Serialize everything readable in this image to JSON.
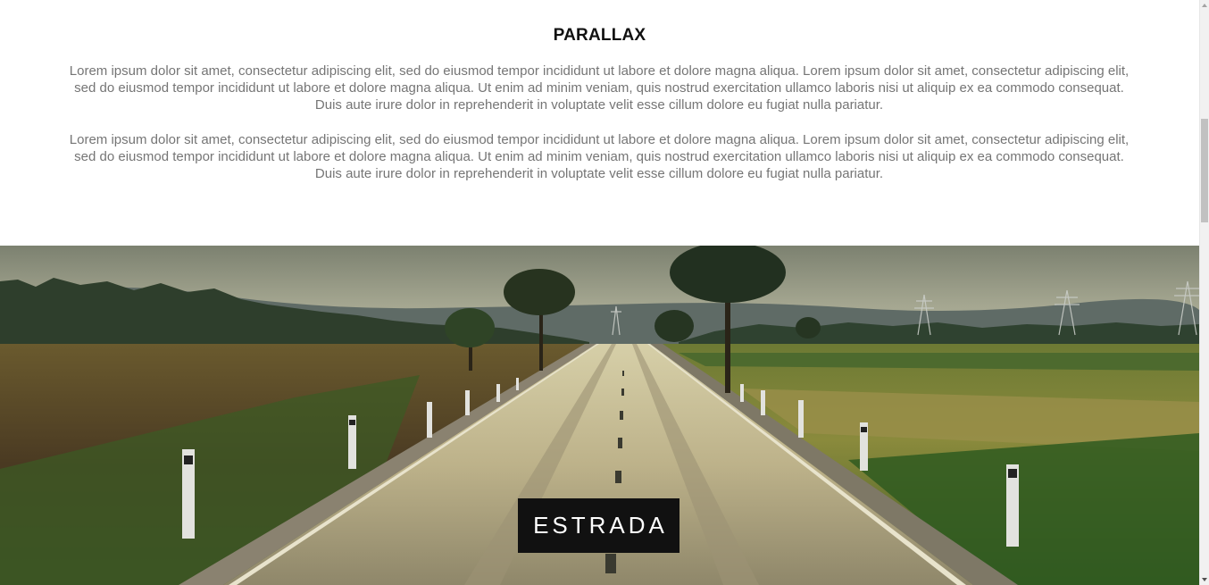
{
  "section": {
    "title": "PARALLAX",
    "paragraphs": [
      "Lorem ipsum dolor sit amet, consectetur adipiscing elit, sed do eiusmod tempor incididunt ut labore et dolore magna aliqua. Lorem ipsum dolor sit amet, consectetur adipiscing elit, sed do eiusmod tempor incididunt ut labore et dolore magna aliqua. Ut enim ad minim veniam, quis nostrud exercitation ullamco laboris nisi ut aliquip ex ea commodo consequat. Duis aute irure dolor in reprehenderit in voluptate velit esse cillum dolore eu fugiat nulla pariatur.",
      "Lorem ipsum dolor sit amet, consectetur adipiscing elit, sed do eiusmod tempor incididunt ut labore et dolore magna aliqua. Lorem ipsum dolor sit amet, consectetur adipiscing elit, sed do eiusmod tempor incididunt ut labore et dolore magna aliqua. Ut enim ad minim veniam, quis nostrud exercitation ullamco laboris nisi ut aliquip ex ea commodo consequat. Duis aute irure dolor in reprehenderit in voluptate velit esse cillum dolore eu fugiat nulla pariatur."
    ]
  },
  "hero": {
    "image_subject": "country-road-landscape",
    "label": "ESTRADA"
  },
  "scrollbar": {
    "up_icon": "triangle-up-icon",
    "down_icon": "triangle-down-icon"
  },
  "colors": {
    "title": "#111111",
    "body_text": "#757575",
    "label_bg": "#111111",
    "label_text": "#ffffff"
  }
}
